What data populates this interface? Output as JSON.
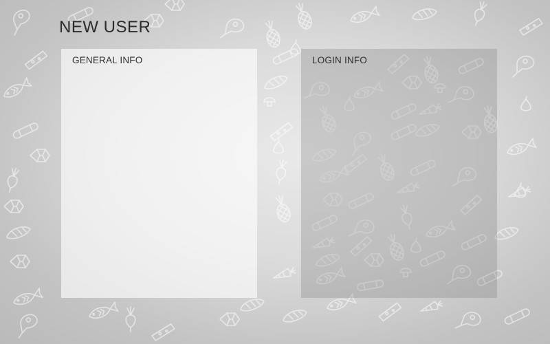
{
  "page": {
    "title": "NEW USER"
  },
  "panels": {
    "general": {
      "title": "GENERAL INFO"
    },
    "login": {
      "title": "LOGIN INFO"
    }
  },
  "background": {
    "base_color": "#cfcfcf",
    "pattern_icons": [
      "fish-icon",
      "cheese-icon",
      "pineapple-icon",
      "sausage-icon",
      "bread-icon",
      "meat-icon",
      "cabbage-icon",
      "carrot-icon",
      "pear-icon",
      "radish-icon",
      "mushroom-icon",
      "ham-icon"
    ]
  }
}
